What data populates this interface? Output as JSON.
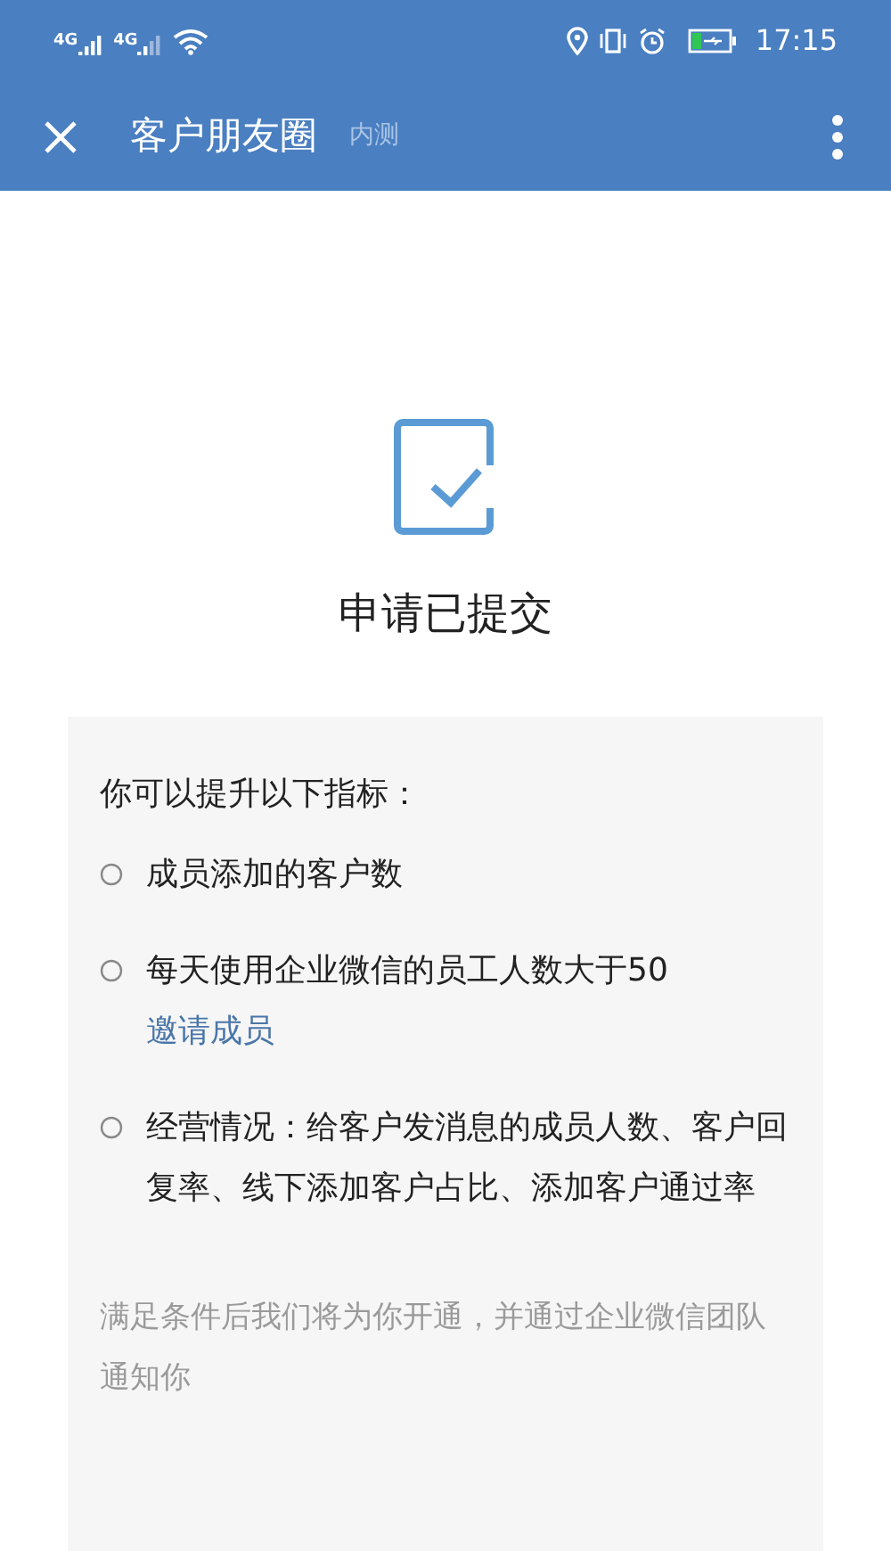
{
  "status_bar": {
    "network_labels": [
      "4G",
      "4G"
    ],
    "time": "17:15"
  },
  "header": {
    "title": "客户朋友圈",
    "badge": "内测"
  },
  "result": {
    "title": "申请已提交"
  },
  "card": {
    "intro": "你可以提升以下指标：",
    "items": [
      {
        "text": "成员添加的客户数"
      },
      {
        "text": "每天使用企业微信的员工人数大于50",
        "link": "邀请成员"
      },
      {
        "text": "经营情况：给客户发消息的成员人数、客户回复率、线下添加客户占比、添加客户通过率"
      }
    ],
    "note": "满足条件后我们将为你开通，并通过企业微信团队通知你"
  }
}
